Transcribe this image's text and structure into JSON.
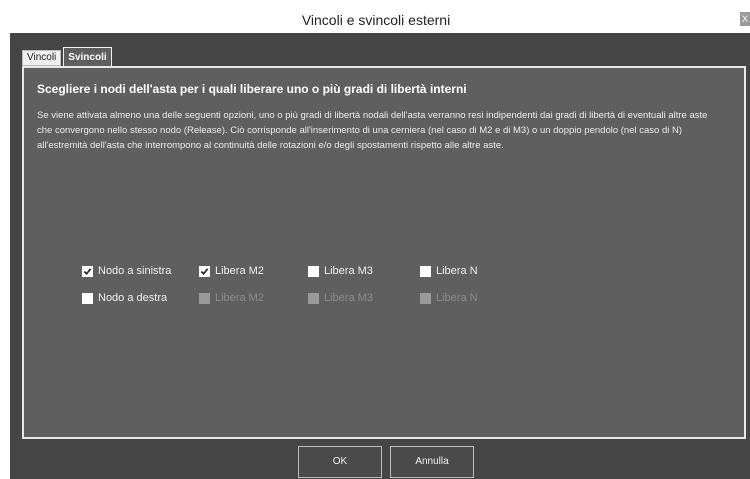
{
  "window": {
    "title": "Vincoli e svincoli esterni",
    "close_label": "X"
  },
  "tabs": [
    {
      "label": "Vincoli",
      "active": false
    },
    {
      "label": "Svincoli",
      "active": true
    }
  ],
  "panel": {
    "heading": "Scegliere i nodi dell'asta per i quali liberare uno o più gradi di libertà interni",
    "description": "Se viene attivata almeno una delle seguenti opzioni, uno o più gradi di libertà nodali dell'asta verranno resi indipendenti dai gradi di libertà di eventuali altre aste che convergono nello stesso nodo (Release). Ciò corrisponde all'inserimento di una cerniera (nel caso di M2 e di M3) o un doppio pendolo (nel caso di N) all'estremità dell'asta che interrompono al continuità delle rotazioni e/o degli spostamenti rispetto alle altre aste."
  },
  "options": {
    "row1": [
      {
        "label": "Nodo a sinistra",
        "checked": true,
        "enabled": true
      },
      {
        "label": "Libera M2",
        "checked": true,
        "enabled": true
      },
      {
        "label": "Libera M3",
        "checked": false,
        "enabled": true
      },
      {
        "label": "Libera N",
        "checked": false,
        "enabled": true
      }
    ],
    "row2": [
      {
        "label": "Nodo a destra",
        "checked": false,
        "enabled": true
      },
      {
        "label": "Libera M2",
        "checked": false,
        "enabled": false
      },
      {
        "label": "Libera M3",
        "checked": false,
        "enabled": false
      },
      {
        "label": "Libera N",
        "checked": false,
        "enabled": false
      }
    ]
  },
  "buttons": {
    "ok": "OK",
    "cancel": "Annulla"
  },
  "colors": {
    "dialog_bg": "#454545",
    "panel_bg": "#5f5f5f",
    "panel_border": "#e8e8e8"
  }
}
